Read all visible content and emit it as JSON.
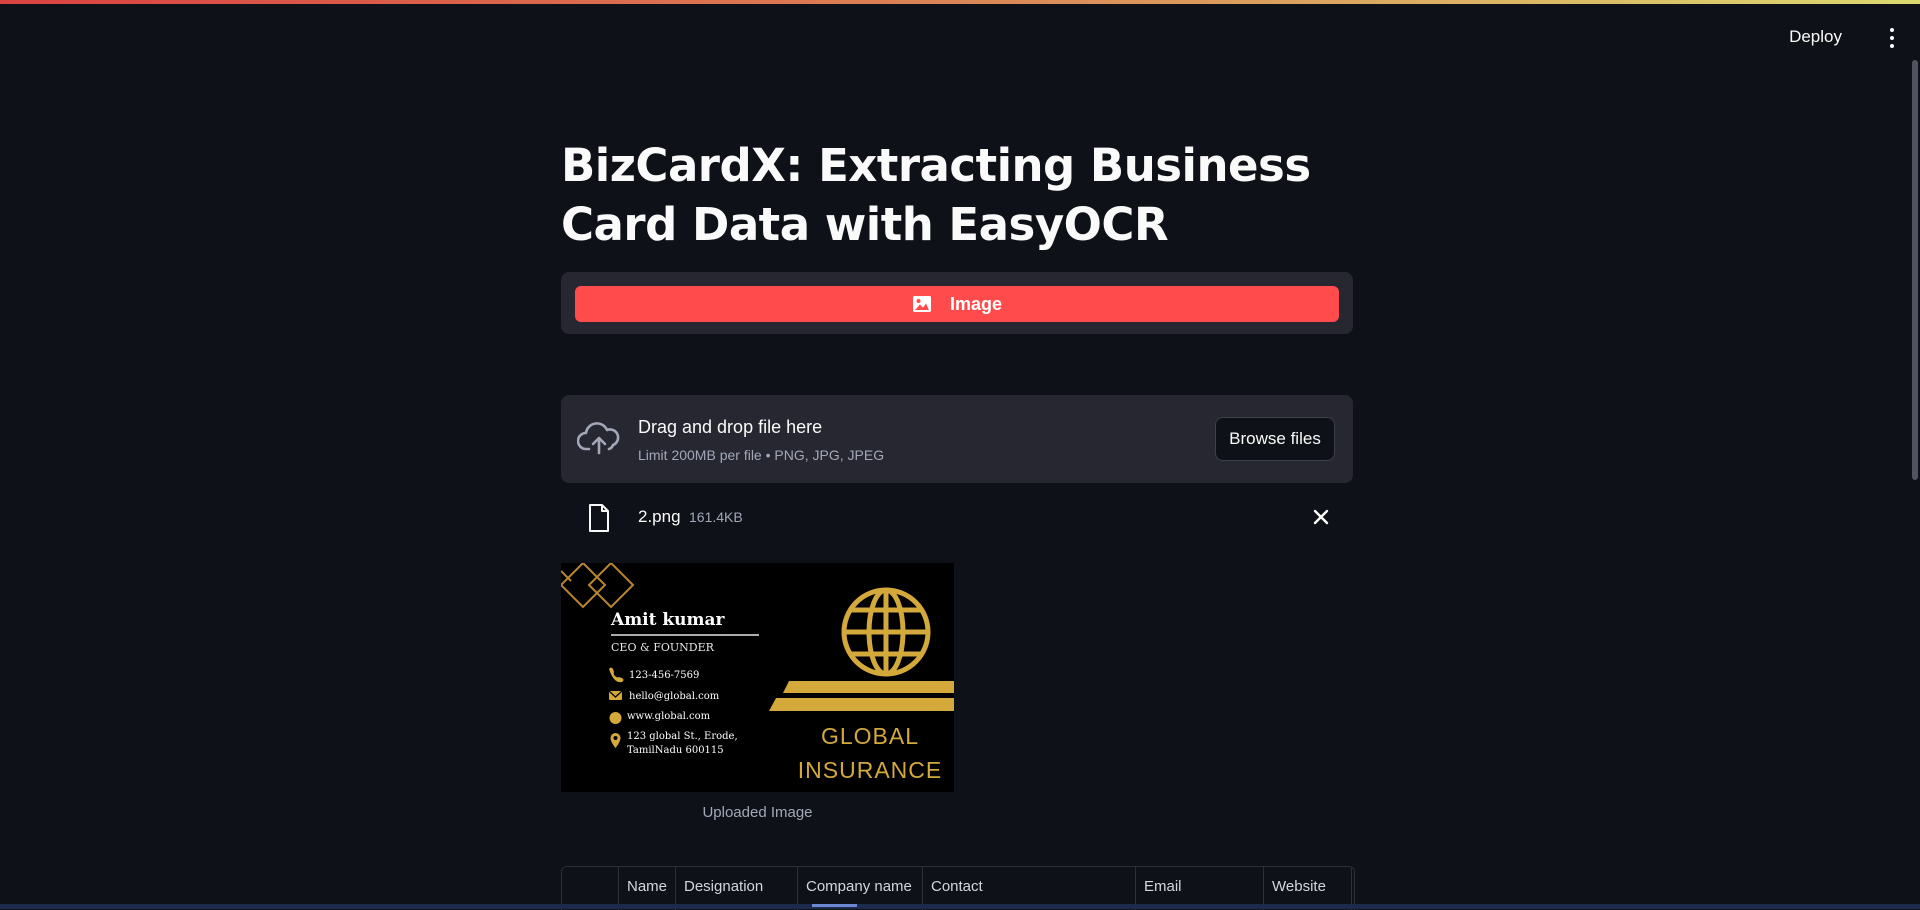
{
  "header": {
    "deploy_label": "Deploy",
    "menu_icon": "kebab-menu-icon"
  },
  "page": {
    "title": "BizCardX: Extracting Business Card Data with EasyOCR"
  },
  "tabs": [
    {
      "label": "Image",
      "icon": "image-icon",
      "active": true
    }
  ],
  "uploader": {
    "icon": "cloud-upload-icon",
    "drop_text": "Drag and drop file here",
    "limit_text": "Limit 200MB per file • PNG, JPG, JPEG",
    "browse_label": "Browse files"
  },
  "uploaded_file": {
    "icon": "file-icon",
    "name": "2.png",
    "size": "161.4KB",
    "remove_icon": "close-icon"
  },
  "card_image": {
    "name": "Amit kumar",
    "designation": "CEO & FOUNDER",
    "phone": "123-456-7569",
    "email": "hello@global.com",
    "website": "www.global.com",
    "address_line1": "123 global St., Erode,",
    "address_line2": "TamilNadu 600115",
    "company_line1": "GLOBAL",
    "company_line2": "INSURANCE",
    "caption": "Uploaded Image"
  },
  "table": {
    "columns": [
      "",
      "Name",
      "Designation",
      "Company name",
      "Contact",
      "Email",
      "Website"
    ]
  },
  "colors": {
    "background": "#0e1117",
    "panel": "#262730",
    "accent": "#ff4b4b",
    "gold": "#d4a93c"
  }
}
